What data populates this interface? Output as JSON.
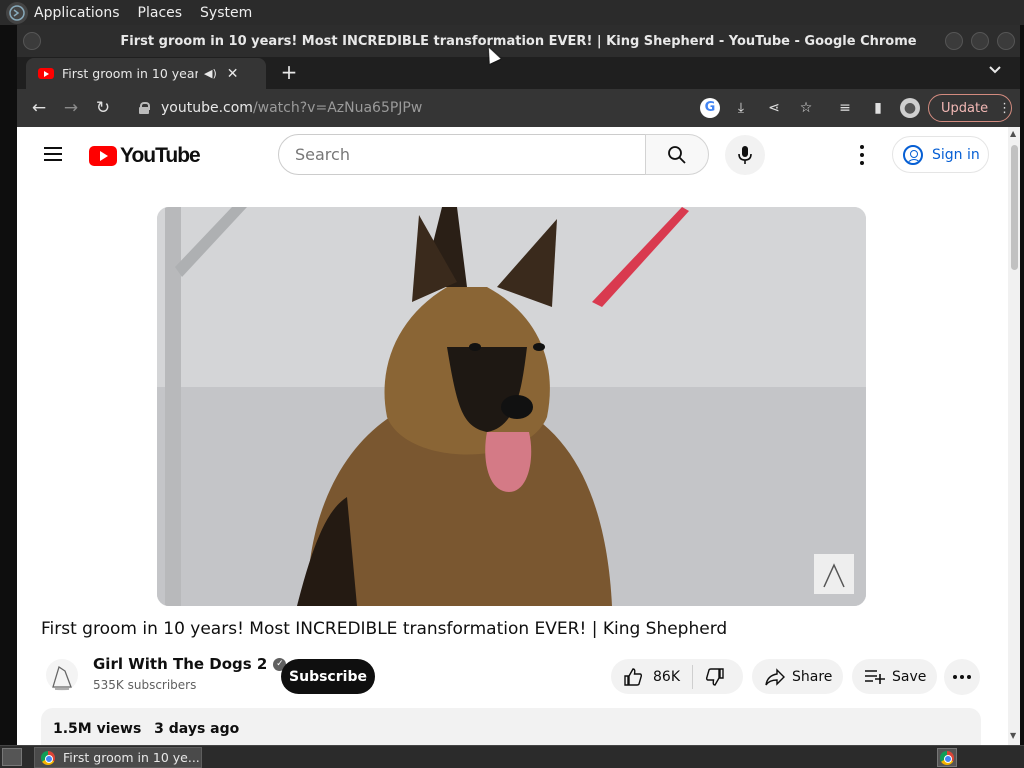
{
  "desktop": {
    "menus": [
      "Applications",
      "Places",
      "System"
    ]
  },
  "window": {
    "title": "First groom in 10 years! Most INCREDIBLE transformation EVER! | King Shepherd - YouTube - Google Chrome"
  },
  "tabs": [
    {
      "title": "First groom in 10 years! Most INCREDIBLE transformation EVER! | King Shepherd - YouTube",
      "audio": true
    }
  ],
  "omnibox": {
    "host": "youtube.com",
    "path": "/watch?v=AzNua65PJPw"
  },
  "browser": {
    "update_label": "Update"
  },
  "youtube": {
    "logo_text": "YouTube",
    "search_placeholder": "Search",
    "signin_label": "Sign in"
  },
  "video": {
    "title": "First groom in 10 years! Most INCREDIBLE transformation EVER! | King Shepherd",
    "channel": "Girl With The Dogs 2",
    "subscribers": "535K subscribers",
    "subscribe_label": "Subscribe",
    "likes": "86K",
    "share_label": "Share",
    "save_label": "Save",
    "views": "1.5M views",
    "age": "3 days ago"
  },
  "taskbar": {
    "task_title": "First groom in 10 ye..."
  },
  "colors": {
    "youtube_red": "#ff0000",
    "link_blue": "#065fd4",
    "chrome_dark": "#353535"
  }
}
